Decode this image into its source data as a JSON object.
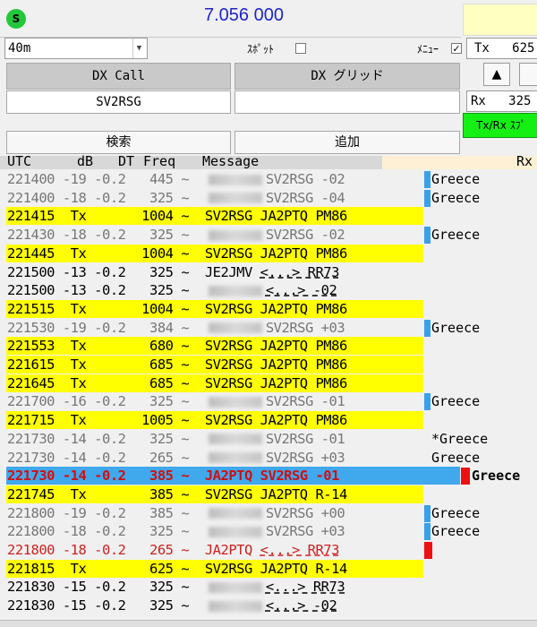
{
  "header": {
    "status_dot": "S",
    "frequency": "7.056 000"
  },
  "controls": {
    "band": "40m",
    "spot_label": "ｽﾎﾟｯﾄ",
    "menu_label": "ﾒﾆｭｰ",
    "menu_check": "✓",
    "tx_label": "Tx   625",
    "dx_call_label": "DX Call",
    "dx_grid_label": "DX グリッド",
    "dx_call_value": "SV2RSG",
    "dx_grid_value": "",
    "up_label": "▲",
    "rx_label": "Rx   325",
    "txrx_label": "Tx/Rx ｽﾌﾟ",
    "search_label": "検索",
    "add_label": "追加"
  },
  "list": {
    "columns": [
      "UTC",
      "dB",
      "DT",
      "Freq",
      "Message"
    ],
    "rx_label": "Rx",
    "rows": [
      {
        "utc": "221400",
        "db": "-19",
        "dt": "-0.2",
        "freq": "445",
        "pre": "",
        "blur": true,
        "msg": "SV2RSG -02",
        "dash": false,
        "style": "gray",
        "mark": "blue",
        "country": "Greece"
      },
      {
        "utc": "221400",
        "db": "-18",
        "dt": "-0.2",
        "freq": "325",
        "pre": "",
        "blur": true,
        "msg": "SV2RSG -04",
        "dash": false,
        "style": "gray",
        "mark": "blue",
        "country": "Greece"
      },
      {
        "utc": "221415",
        "db": "Tx",
        "dt": "",
        "freq": "1004",
        "pre": "SV2RSG JA2PTQ PM86",
        "blur": false,
        "msg": "",
        "dash": false,
        "style": "yellow",
        "mark": "",
        "country": ""
      },
      {
        "utc": "221430",
        "db": "-18",
        "dt": "-0.2",
        "freq": "325",
        "pre": "",
        "blur": true,
        "msg": "SV2RSG -02",
        "dash": false,
        "style": "gray",
        "mark": "blue",
        "country": "Greece"
      },
      {
        "utc": "221445",
        "db": "Tx",
        "dt": "",
        "freq": "1004",
        "pre": "SV2RSG JA2PTQ PM86",
        "blur": false,
        "msg": "",
        "dash": false,
        "style": "yellow",
        "mark": "",
        "country": ""
      },
      {
        "utc": "221500",
        "db": "-13",
        "dt": "-0.2",
        "freq": "325",
        "pre": "JE2JMV",
        "blur": false,
        "msg": "<...> RR73",
        "dash": true,
        "style": "black",
        "mark": "",
        "country": ""
      },
      {
        "utc": "221500",
        "db": "-13",
        "dt": "-0.2",
        "freq": "325",
        "pre": "",
        "blur": true,
        "msg": "<...> -02",
        "dash": true,
        "style": "black",
        "mark": "",
        "country": ""
      },
      {
        "utc": "221515",
        "db": "Tx",
        "dt": "",
        "freq": "1004",
        "pre": "SV2RSG JA2PTQ PM86",
        "blur": false,
        "msg": "",
        "dash": false,
        "style": "yellow",
        "mark": "",
        "country": ""
      },
      {
        "utc": "221530",
        "db": "-19",
        "dt": "-0.2",
        "freq": "384",
        "pre": "",
        "blur": true,
        "msg": "SV2RSG +03",
        "dash": false,
        "style": "gray",
        "mark": "blue",
        "country": "Greece"
      },
      {
        "utc": "221553",
        "db": "Tx",
        "dt": "",
        "freq": "680",
        "pre": "SV2RSG JA2PTQ PM86",
        "blur": false,
        "msg": "",
        "dash": false,
        "style": "yellow",
        "mark": "",
        "country": ""
      },
      {
        "utc": "221615",
        "db": "Tx",
        "dt": "",
        "freq": "685",
        "pre": "SV2RSG JA2PTQ PM86",
        "blur": false,
        "msg": "",
        "dash": false,
        "style": "yellow",
        "mark": "",
        "country": ""
      },
      {
        "utc": "221645",
        "db": "Tx",
        "dt": "",
        "freq": "685",
        "pre": "SV2RSG JA2PTQ PM86",
        "blur": false,
        "msg": "",
        "dash": false,
        "style": "yellow",
        "mark": "",
        "country": ""
      },
      {
        "utc": "221700",
        "db": "-16",
        "dt": "-0.2",
        "freq": "325",
        "pre": "",
        "blur": true,
        "msg": "SV2RSG -01",
        "dash": false,
        "style": "gray",
        "mark": "blue",
        "country": "Greece"
      },
      {
        "utc": "221715",
        "db": "Tx",
        "dt": "",
        "freq": "1005",
        "pre": "SV2RSG JA2PTQ PM86",
        "blur": false,
        "msg": "",
        "dash": false,
        "style": "yellow",
        "mark": "",
        "country": ""
      },
      {
        "utc": "221730",
        "db": "-14",
        "dt": "-0.2",
        "freq": "325",
        "pre": "",
        "blur": true,
        "msg": "SV2RSG -01",
        "dash": false,
        "style": "gray",
        "mark": "",
        "country": "*Greece"
      },
      {
        "utc": "221730",
        "db": "-14",
        "dt": "-0.2",
        "freq": "265",
        "pre": "",
        "blur": true,
        "msg": "SV2RSG +03",
        "dash": false,
        "style": "gray",
        "mark": "",
        "country": "Greece"
      },
      {
        "utc": "221730",
        "db": "-14",
        "dt": "-0.2",
        "freq": "385",
        "pre": "JA2PTQ SV2RSG -01",
        "blur": false,
        "msg": "",
        "dash": false,
        "style": "hl",
        "mark": "red",
        "country": "Greece"
      },
      {
        "utc": "221745",
        "db": "Tx",
        "dt": "",
        "freq": "385",
        "pre": "SV2RSG JA2PTQ R-14",
        "blur": false,
        "msg": "",
        "dash": false,
        "style": "yellow",
        "mark": "",
        "country": ""
      },
      {
        "utc": "221800",
        "db": "-19",
        "dt": "-0.2",
        "freq": "385",
        "pre": "",
        "blur": true,
        "msg": "SV2RSG +00",
        "dash": false,
        "style": "gray",
        "mark": "blue",
        "country": "Greece"
      },
      {
        "utc": "221800",
        "db": "-18",
        "dt": "-0.2",
        "freq": "325",
        "pre": "",
        "blur": true,
        "msg": "SV2RSG +03",
        "dash": false,
        "style": "gray",
        "mark": "blue",
        "country": "Greece"
      },
      {
        "utc": "221800",
        "db": "-18",
        "dt": "-0.2",
        "freq": "265",
        "pre": "JA2PTQ",
        "blur": false,
        "msg": "<...> RR73",
        "dash": true,
        "style": "red",
        "mark": "redbar",
        "country": ""
      },
      {
        "utc": "221815",
        "db": "Tx",
        "dt": "",
        "freq": "625",
        "pre": "SV2RSG JA2PTQ R-14",
        "blur": false,
        "msg": "",
        "dash": false,
        "style": "yellow",
        "mark": "",
        "country": ""
      },
      {
        "utc": "221830",
        "db": "-15",
        "dt": "-0.2",
        "freq": "325",
        "pre": "",
        "blur": true,
        "msg": "<...> RR73",
        "dash": true,
        "style": "black",
        "mark": "",
        "country": ""
      },
      {
        "utc": "221830",
        "db": "-15",
        "dt": "-0.2",
        "freq": "325",
        "pre": "",
        "blur": true,
        "msg": "<...> -02",
        "dash": true,
        "style": "black",
        "mark": "",
        "country": ""
      }
    ]
  }
}
